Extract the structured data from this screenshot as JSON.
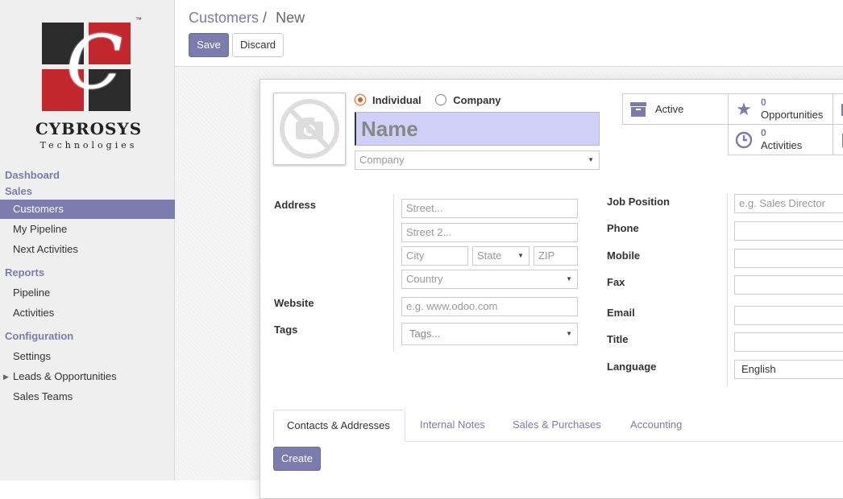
{
  "brand": {
    "name": "CYBROSYS",
    "tagline": "Technologies",
    "tm": "™",
    "mark": "C",
    "colors": {
      "red": "#c1272d",
      "dark": "#2b2b2b"
    }
  },
  "sidebar": {
    "sections": {
      "dashboard": "Dashboard",
      "sales": "Sales",
      "reports": "Reports",
      "configuration": "Configuration"
    },
    "sales_items": [
      "Customers",
      "My Pipeline",
      "Next Activities"
    ],
    "report_items": [
      "Pipeline",
      "Activities"
    ],
    "config_items": [
      "Settings",
      "Leads & Opportunities",
      "Sales Teams"
    ],
    "active_item": "Customers"
  },
  "breadcrumb": {
    "parent": "Customers",
    "separator": "/",
    "current": "New"
  },
  "toolbar": {
    "save": "Save",
    "discard": "Discard"
  },
  "form": {
    "type_options": [
      "Individual",
      "Company"
    ],
    "type_selected": "Individual",
    "name_placeholder": "Name",
    "company_placeholder": "Company",
    "stats": [
      {
        "icon": "archive-icon",
        "label": "Active"
      },
      {
        "icon": "star-icon",
        "count": "0",
        "label": "Opportunities"
      },
      {
        "icon": "clock-icon",
        "count": "0",
        "label": "Activities"
      }
    ],
    "left_labels": {
      "address": "Address",
      "website": "Website",
      "tags": "Tags"
    },
    "address": {
      "street": "Street...",
      "street2": "Street 2...",
      "city": "City",
      "state": "State",
      "zip": "ZIP",
      "country": "Country"
    },
    "website_placeholder": "e.g. www.odoo.com",
    "tags_placeholder": "Tags...",
    "right_labels": {
      "job": "Job Position",
      "phone": "Phone",
      "mobile": "Mobile",
      "fax": "Fax",
      "email": "Email",
      "title": "Title",
      "language": "Language"
    },
    "job_placeholder": "e.g. Sales Director",
    "language_value": "English"
  },
  "tabs": [
    "Contacts & Addresses",
    "Internal Notes",
    "Sales & Purchases",
    "Accounting"
  ],
  "active_tab": "Contacts & Addresses",
  "create_button": "Create",
  "accent": "#7c7bad"
}
